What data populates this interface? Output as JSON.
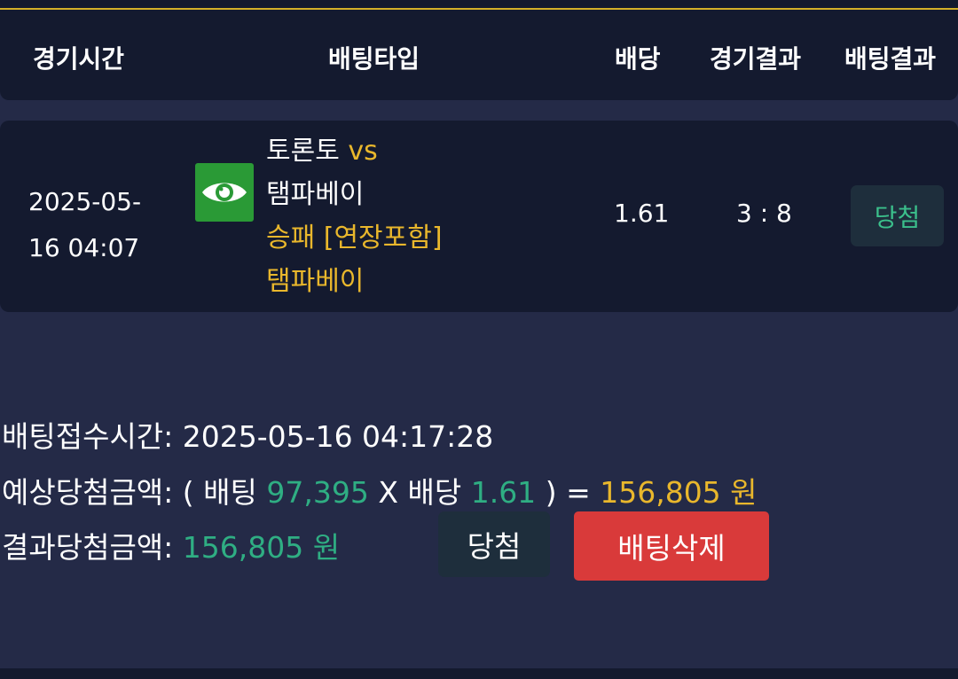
{
  "header": {
    "col_time": "경기시간",
    "col_type": "배팅타입",
    "col_odds": "배당",
    "col_game_result": "경기결과",
    "col_bet_result": "배팅결과"
  },
  "bet": {
    "date_line1": "2025-05-",
    "date_line2": "16 04:07",
    "detail_icon": "eye-icon",
    "home_team": "토론토",
    "vs": "vs",
    "away_team": "탬파베이",
    "market": "승패 [연장포함]",
    "pick": "탬파베이",
    "odds": "1.61",
    "score": "3 : 8",
    "result": "당첨"
  },
  "summary": {
    "accept_label": "배팅접수시간:",
    "accept_time": "2025-05-16 04:17:28",
    "expected_label": "예상당첨금액:",
    "open_paren": "(",
    "bet_word": "배팅",
    "bet_amount": "97,395",
    "times": "X",
    "odds_word": "배당",
    "odds_value": "1.61",
    "close_paren": ")",
    "equals": "=",
    "expected_amount": "156,805 원",
    "result_label": "결과당첨금액:",
    "result_amount": "156,805 원"
  },
  "actions": {
    "win_label": "당첨",
    "delete_label": "배팅삭제"
  },
  "colors": {
    "background": "#242a47",
    "panel": "#141a2f",
    "gold": "#e9b72c",
    "green": "#2fae83",
    "delete_red": "#d93a3a",
    "eye_green": "#2a9a36"
  }
}
